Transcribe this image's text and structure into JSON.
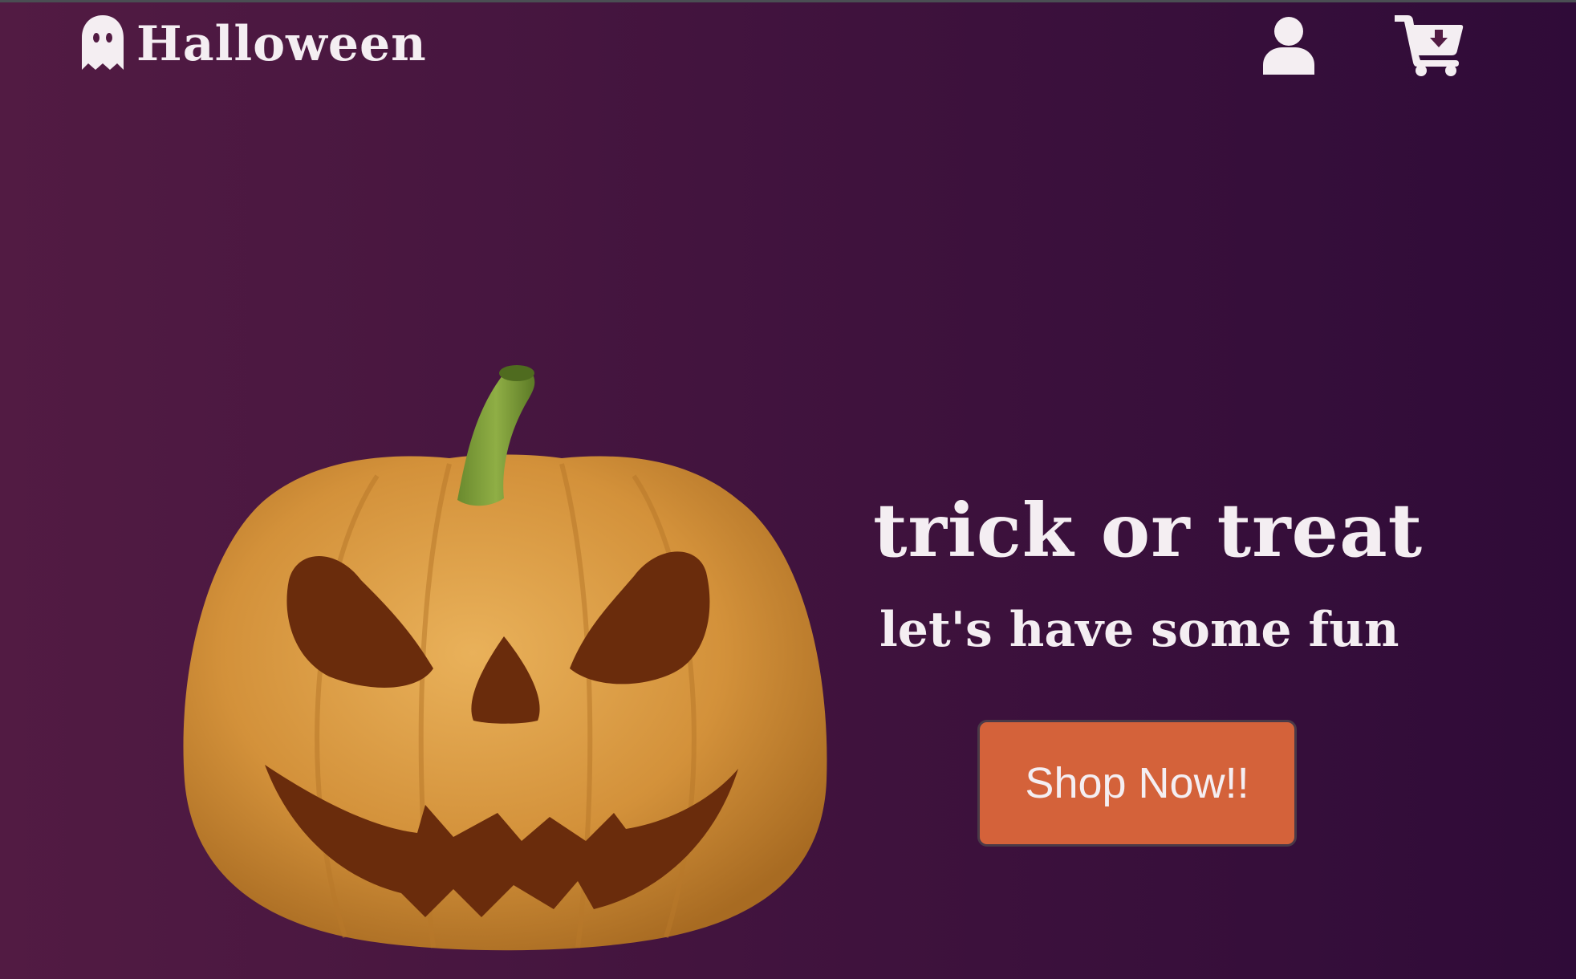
{
  "header": {
    "logo_text": "Halloween",
    "logo_icon": "ghost-icon",
    "account_icon": "user-icon",
    "cart_icon": "cart-download-icon"
  },
  "hero": {
    "title": "trick or treat",
    "subtitle": "let's have some fun",
    "cta_label": "Shop Now!!",
    "image": "jack-o-lantern-pumpkin"
  },
  "colors": {
    "background_left": "#521b43",
    "background_right": "#2f0b38",
    "text": "#f4eef2",
    "button": "#d4623a",
    "pumpkin": "#d99a3c",
    "stem": "#7c9a3a"
  }
}
